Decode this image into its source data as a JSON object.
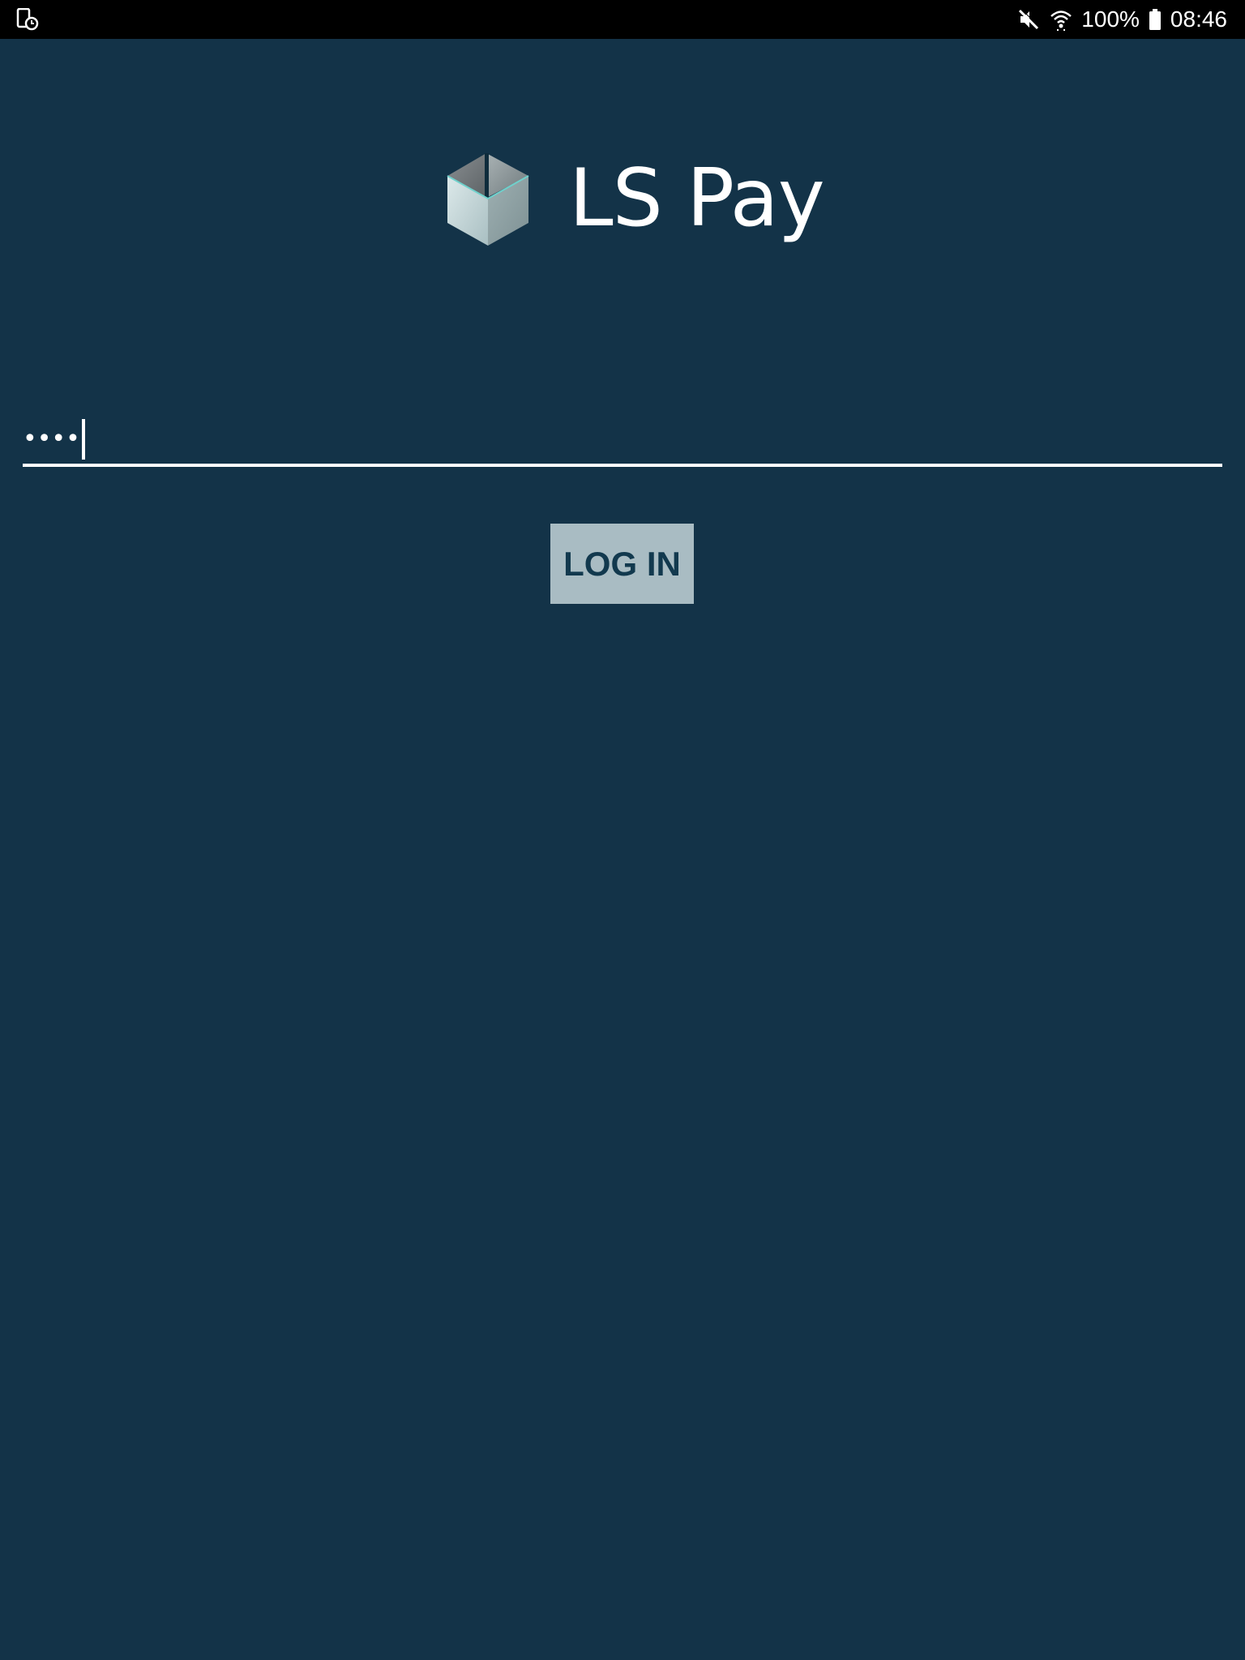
{
  "status_bar": {
    "left_icon": "screen-timer-icon",
    "mute_icon": "mute-icon",
    "wifi_icon": "wifi-icon",
    "battery_text": "100%",
    "battery_icon": "battery-icon",
    "time": "08:46"
  },
  "app": {
    "name": "LS Pay",
    "logo_icon": "cube-logo-icon"
  },
  "login": {
    "password_value": "••••",
    "button_label": "LOG IN"
  },
  "colors": {
    "background": "#133348",
    "button_bg": "#a9bcc3",
    "button_text": "#12394e",
    "status_bar": "#000000"
  }
}
